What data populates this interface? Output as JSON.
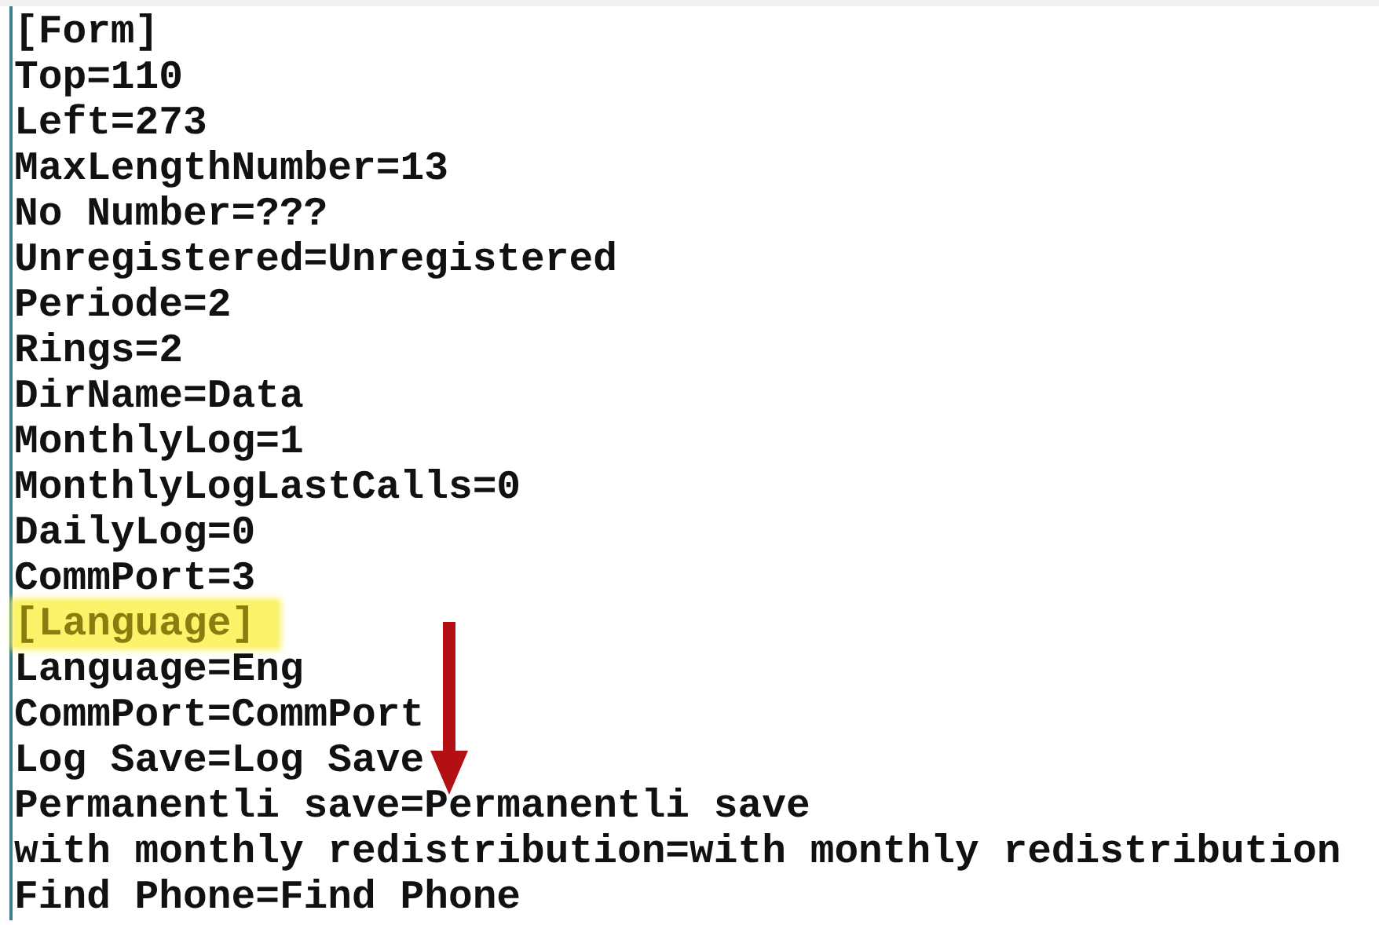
{
  "editor": {
    "lines": [
      {
        "text": "[Form]",
        "highlighted": false
      },
      {
        "text": "Top=110",
        "highlighted": false
      },
      {
        "text": "Left=273",
        "highlighted": false
      },
      {
        "text": "MaxLengthNumber=13",
        "highlighted": false
      },
      {
        "text": "No Number=???",
        "highlighted": false
      },
      {
        "text": "Unregistered=Unregistered",
        "highlighted": false
      },
      {
        "text": "Periode=2",
        "highlighted": false
      },
      {
        "text": "Rings=2",
        "highlighted": false
      },
      {
        "text": "DirName=Data",
        "highlighted": false
      },
      {
        "text": "MonthlyLog=1",
        "highlighted": false
      },
      {
        "text": "MonthlyLogLastCalls=0",
        "highlighted": false
      },
      {
        "text": "DailyLog=0",
        "highlighted": false
      },
      {
        "text": "CommPort=3",
        "highlighted": false
      },
      {
        "text": "[Language]",
        "highlighted": true
      },
      {
        "text": "Language=Eng",
        "highlighted": false
      },
      {
        "text": "CommPort=CommPort",
        "highlighted": false
      },
      {
        "text": "Log Save=Log Save",
        "highlighted": false
      },
      {
        "text": "Permanentli save=Permanentli save",
        "highlighted": false
      },
      {
        "text": "with monthly redistribution=with monthly redistribution",
        "highlighted": false
      },
      {
        "text": "Find Phone=Find Phone",
        "highlighted": false
      }
    ]
  }
}
